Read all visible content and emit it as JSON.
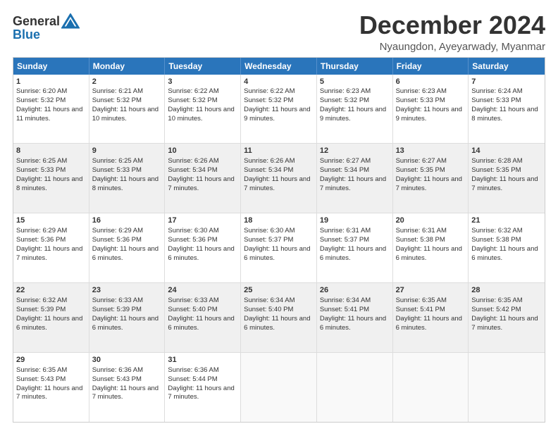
{
  "logo": {
    "line1": "General",
    "line2": "Blue"
  },
  "title": "December 2024",
  "subtitle": "Nyaungdon, Ayeyarwady, Myanmar",
  "header_days": [
    "Sunday",
    "Monday",
    "Tuesday",
    "Wednesday",
    "Thursday",
    "Friday",
    "Saturday"
  ],
  "rows": [
    [
      {
        "day": "1",
        "rise": "Sunrise: 6:20 AM",
        "set": "Sunset: 5:32 PM",
        "daylight": "Daylight: 11 hours and 11 minutes."
      },
      {
        "day": "2",
        "rise": "Sunrise: 6:21 AM",
        "set": "Sunset: 5:32 PM",
        "daylight": "Daylight: 11 hours and 10 minutes."
      },
      {
        "day": "3",
        "rise": "Sunrise: 6:22 AM",
        "set": "Sunset: 5:32 PM",
        "daylight": "Daylight: 11 hours and 10 minutes."
      },
      {
        "day": "4",
        "rise": "Sunrise: 6:22 AM",
        "set": "Sunset: 5:32 PM",
        "daylight": "Daylight: 11 hours and 9 minutes."
      },
      {
        "day": "5",
        "rise": "Sunrise: 6:23 AM",
        "set": "Sunset: 5:32 PM",
        "daylight": "Daylight: 11 hours and 9 minutes."
      },
      {
        "day": "6",
        "rise": "Sunrise: 6:23 AM",
        "set": "Sunset: 5:33 PM",
        "daylight": "Daylight: 11 hours and 9 minutes."
      },
      {
        "day": "7",
        "rise": "Sunrise: 6:24 AM",
        "set": "Sunset: 5:33 PM",
        "daylight": "Daylight: 11 hours and 8 minutes."
      }
    ],
    [
      {
        "day": "8",
        "rise": "Sunrise: 6:25 AM",
        "set": "Sunset: 5:33 PM",
        "daylight": "Daylight: 11 hours and 8 minutes."
      },
      {
        "day": "9",
        "rise": "Sunrise: 6:25 AM",
        "set": "Sunset: 5:33 PM",
        "daylight": "Daylight: 11 hours and 8 minutes."
      },
      {
        "day": "10",
        "rise": "Sunrise: 6:26 AM",
        "set": "Sunset: 5:34 PM",
        "daylight": "Daylight: 11 hours and 7 minutes."
      },
      {
        "day": "11",
        "rise": "Sunrise: 6:26 AM",
        "set": "Sunset: 5:34 PM",
        "daylight": "Daylight: 11 hours and 7 minutes."
      },
      {
        "day": "12",
        "rise": "Sunrise: 6:27 AM",
        "set": "Sunset: 5:34 PM",
        "daylight": "Daylight: 11 hours and 7 minutes."
      },
      {
        "day": "13",
        "rise": "Sunrise: 6:27 AM",
        "set": "Sunset: 5:35 PM",
        "daylight": "Daylight: 11 hours and 7 minutes."
      },
      {
        "day": "14",
        "rise": "Sunrise: 6:28 AM",
        "set": "Sunset: 5:35 PM",
        "daylight": "Daylight: 11 hours and 7 minutes."
      }
    ],
    [
      {
        "day": "15",
        "rise": "Sunrise: 6:29 AM",
        "set": "Sunset: 5:36 PM",
        "daylight": "Daylight: 11 hours and 7 minutes."
      },
      {
        "day": "16",
        "rise": "Sunrise: 6:29 AM",
        "set": "Sunset: 5:36 PM",
        "daylight": "Daylight: 11 hours and 6 minutes."
      },
      {
        "day": "17",
        "rise": "Sunrise: 6:30 AM",
        "set": "Sunset: 5:36 PM",
        "daylight": "Daylight: 11 hours and 6 minutes."
      },
      {
        "day": "18",
        "rise": "Sunrise: 6:30 AM",
        "set": "Sunset: 5:37 PM",
        "daylight": "Daylight: 11 hours and 6 minutes."
      },
      {
        "day": "19",
        "rise": "Sunrise: 6:31 AM",
        "set": "Sunset: 5:37 PM",
        "daylight": "Daylight: 11 hours and 6 minutes."
      },
      {
        "day": "20",
        "rise": "Sunrise: 6:31 AM",
        "set": "Sunset: 5:38 PM",
        "daylight": "Daylight: 11 hours and 6 minutes."
      },
      {
        "day": "21",
        "rise": "Sunrise: 6:32 AM",
        "set": "Sunset: 5:38 PM",
        "daylight": "Daylight: 11 hours and 6 minutes."
      }
    ],
    [
      {
        "day": "22",
        "rise": "Sunrise: 6:32 AM",
        "set": "Sunset: 5:39 PM",
        "daylight": "Daylight: 11 hours and 6 minutes."
      },
      {
        "day": "23",
        "rise": "Sunrise: 6:33 AM",
        "set": "Sunset: 5:39 PM",
        "daylight": "Daylight: 11 hours and 6 minutes."
      },
      {
        "day": "24",
        "rise": "Sunrise: 6:33 AM",
        "set": "Sunset: 5:40 PM",
        "daylight": "Daylight: 11 hours and 6 minutes."
      },
      {
        "day": "25",
        "rise": "Sunrise: 6:34 AM",
        "set": "Sunset: 5:40 PM",
        "daylight": "Daylight: 11 hours and 6 minutes."
      },
      {
        "day": "26",
        "rise": "Sunrise: 6:34 AM",
        "set": "Sunset: 5:41 PM",
        "daylight": "Daylight: 11 hours and 6 minutes."
      },
      {
        "day": "27",
        "rise": "Sunrise: 6:35 AM",
        "set": "Sunset: 5:41 PM",
        "daylight": "Daylight: 11 hours and 6 minutes."
      },
      {
        "day": "28",
        "rise": "Sunrise: 6:35 AM",
        "set": "Sunset: 5:42 PM",
        "daylight": "Daylight: 11 hours and 7 minutes."
      }
    ],
    [
      {
        "day": "29",
        "rise": "Sunrise: 6:35 AM",
        "set": "Sunset: 5:43 PM",
        "daylight": "Daylight: 11 hours and 7 minutes."
      },
      {
        "day": "30",
        "rise": "Sunrise: 6:36 AM",
        "set": "Sunset: 5:43 PM",
        "daylight": "Daylight: 11 hours and 7 minutes."
      },
      {
        "day": "31",
        "rise": "Sunrise: 6:36 AM",
        "set": "Sunset: 5:44 PM",
        "daylight": "Daylight: 11 hours and 7 minutes."
      },
      {
        "day": "",
        "rise": "",
        "set": "",
        "daylight": ""
      },
      {
        "day": "",
        "rise": "",
        "set": "",
        "daylight": ""
      },
      {
        "day": "",
        "rise": "",
        "set": "",
        "daylight": ""
      },
      {
        "day": "",
        "rise": "",
        "set": "",
        "daylight": ""
      }
    ]
  ]
}
